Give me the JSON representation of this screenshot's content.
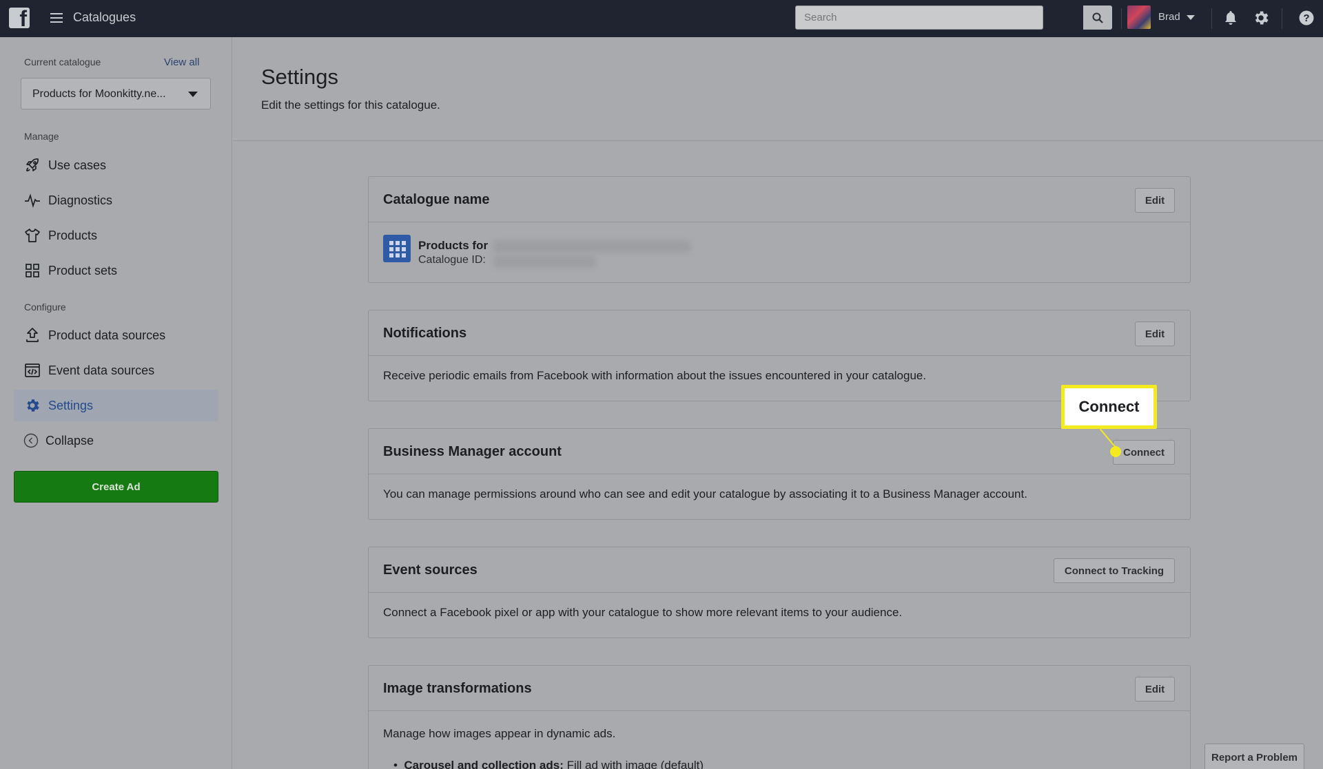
{
  "topbar": {
    "app_title": "Catalogues",
    "search_placeholder": "Search",
    "user_name": "Brad"
  },
  "sidebar": {
    "current_catalogue_label": "Current catalogue",
    "view_all": "View all",
    "catalogue_selected": "Products for Moonkitty.ne...",
    "manage_label": "Manage",
    "configure_label": "Configure",
    "items": [
      {
        "label": "Use cases",
        "icon": "rocket-icon"
      },
      {
        "label": "Diagnostics",
        "icon": "pulse-icon"
      },
      {
        "label": "Products",
        "icon": "shirt-icon"
      },
      {
        "label": "Product sets",
        "icon": "grid-icon"
      },
      {
        "label": "Product data sources",
        "icon": "upload-icon"
      },
      {
        "label": "Event data sources",
        "icon": "code-window-icon"
      },
      {
        "label": "Settings",
        "icon": "gear-icon",
        "active": true
      },
      {
        "label": "Collapse",
        "icon": "chevron-left-circle-icon"
      }
    ],
    "create_ad": "Create Ad"
  },
  "header": {
    "title": "Settings",
    "subtitle": "Edit the settings for this catalogue."
  },
  "cards": {
    "catalogue_name": {
      "title": "Catalogue name",
      "button": "Edit",
      "name_prefix": "Products for",
      "id_label": "Catalogue ID:"
    },
    "notifications": {
      "title": "Notifications",
      "button": "Edit",
      "body": "Receive periodic emails from Facebook with information about the issues encountered in your catalogue."
    },
    "business_manager": {
      "title": "Business Manager account",
      "button": "Connect",
      "body": "You can manage permissions around who can see and edit your catalogue by associating it to a Business Manager account."
    },
    "event_sources": {
      "title": "Event sources",
      "button": "Connect to Tracking",
      "body": "Connect a Facebook pixel or app with your catalogue to show more relevant items to your audience."
    },
    "image_transformations": {
      "title": "Image transformations",
      "button": "Edit",
      "body": "Manage how images appear in dynamic ads.",
      "bullet_bold": "Carousel and collection ads:",
      "bullet_rest": " Fill ad with image (default)"
    }
  },
  "callout": {
    "label": "Connect",
    "color": "#f3ea1f"
  },
  "footer": {
    "report_problem": "Report a Problem"
  }
}
